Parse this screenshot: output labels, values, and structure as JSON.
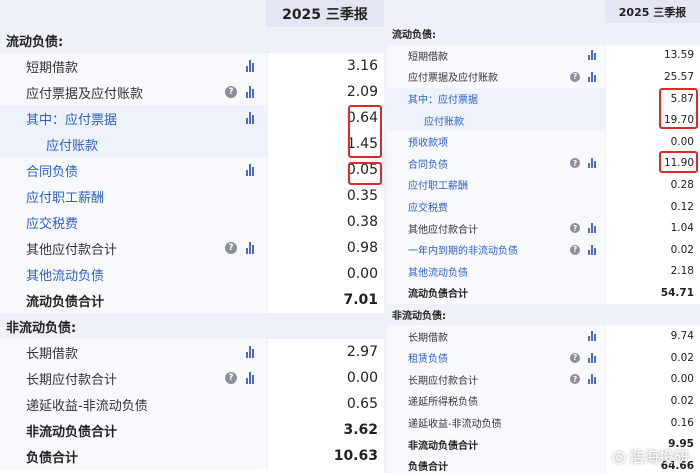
{
  "left": {
    "period": "2025 三季报",
    "rows": [
      {
        "label": "流动负债:",
        "value": "",
        "type": "section"
      },
      {
        "label": "短期借款",
        "value": "3.16",
        "indent": 2,
        "chart": true
      },
      {
        "label": "应付票据及应付账款",
        "value": "2.09",
        "indent": 2,
        "help": true,
        "chart": true
      },
      {
        "label": "其中：应付票据",
        "value": "0.64",
        "indent": 2,
        "link": true,
        "chart": true,
        "alt": true
      },
      {
        "label": "应付账款",
        "value": "1.45",
        "indent": 4,
        "link": true,
        "alt": true
      },
      {
        "label": "合同负债",
        "value": "0.05",
        "indent": 2,
        "link": true,
        "chart": true
      },
      {
        "label": "应付职工薪酬",
        "value": "0.35",
        "indent": 2,
        "link": true
      },
      {
        "label": "应交税费",
        "value": "0.38",
        "indent": 2,
        "link": true
      },
      {
        "label": "其他应付款合计",
        "value": "0.98",
        "indent": 2,
        "help": true,
        "chart": true
      },
      {
        "label": "其他流动负债",
        "value": "0.00",
        "indent": 2,
        "link": true
      },
      {
        "label": "流动负债合计",
        "value": "7.01",
        "indent": 2,
        "type": "total"
      },
      {
        "label": "非流动负债:",
        "value": "",
        "type": "section"
      },
      {
        "label": "长期借款",
        "value": "2.97",
        "indent": 2,
        "chart": true
      },
      {
        "label": "长期应付款合计",
        "value": "0.00",
        "indent": 2,
        "help": true,
        "chart": true
      },
      {
        "label": "递延收益-非流动负债",
        "value": "0.65",
        "indent": 2
      },
      {
        "label": "非流动负债合计",
        "value": "3.62",
        "indent": 2,
        "type": "total"
      },
      {
        "label": "负债合计",
        "value": "10.63",
        "indent": 2,
        "type": "total"
      }
    ]
  },
  "right": {
    "period": "2025 三季报",
    "rows": [
      {
        "label": "流动负债:",
        "value": "",
        "type": "section"
      },
      {
        "label": "短期借款",
        "value": "13.59",
        "indent": 2,
        "chart": true
      },
      {
        "label": "应付票据及应付账款",
        "value": "25.57",
        "indent": 2,
        "help": true,
        "chart": true
      },
      {
        "label": "其中：应付票据",
        "value": "5.87",
        "indent": 2,
        "link": true,
        "alt": true
      },
      {
        "label": "应付账款",
        "value": "19.70",
        "indent": 4,
        "link": true,
        "alt": true
      },
      {
        "label": "预收款项",
        "value": "0.00",
        "indent": 2,
        "link": true
      },
      {
        "label": "合同负债",
        "value": "11.90",
        "indent": 2,
        "link": true,
        "help": true,
        "chart": true
      },
      {
        "label": "应付职工薪酬",
        "value": "0.28",
        "indent": 2,
        "link": true
      },
      {
        "label": "应交税费",
        "value": "0.12",
        "indent": 2,
        "link": true
      },
      {
        "label": "其他应付款合计",
        "value": "1.04",
        "indent": 2,
        "help": true,
        "chart": true
      },
      {
        "label": "一年内到期的非流动负债",
        "value": "0.02",
        "indent": 2,
        "link": true,
        "help": true,
        "chart": true
      },
      {
        "label": "其他流动负债",
        "value": "2.18",
        "indent": 2,
        "link": true
      },
      {
        "label": "流动负债合计",
        "value": "54.71",
        "indent": 2,
        "type": "total"
      },
      {
        "label": "非流动负债:",
        "value": "",
        "type": "section"
      },
      {
        "label": "长期借款",
        "value": "9.74",
        "indent": 2,
        "chart": true
      },
      {
        "label": "租赁负债",
        "value": "0.02",
        "indent": 2,
        "link": true,
        "help": true,
        "chart": true
      },
      {
        "label": "长期应付款合计",
        "value": "0.00",
        "indent": 2,
        "help": true,
        "chart": true
      },
      {
        "label": "递延所得税负债",
        "value": "0.02",
        "indent": 2
      },
      {
        "label": "递延收益-非流动负债",
        "value": "0.16",
        "indent": 2
      },
      {
        "label": "非流动负债合计",
        "value": "9.95",
        "indent": 2,
        "type": "total"
      },
      {
        "label": "负债合计",
        "value": "64.66",
        "indent": 2,
        "type": "total"
      }
    ]
  },
  "icons": {
    "help": "question-circle-icon",
    "chart": "bar-chart-icon"
  },
  "watermark": {
    "text": "浩海投研"
  },
  "colors": {
    "link": "#2d5fc4",
    "highlight": "#e02a2a",
    "header": "#e3e7f3",
    "chart_icon": "#4f6cc4"
  }
}
